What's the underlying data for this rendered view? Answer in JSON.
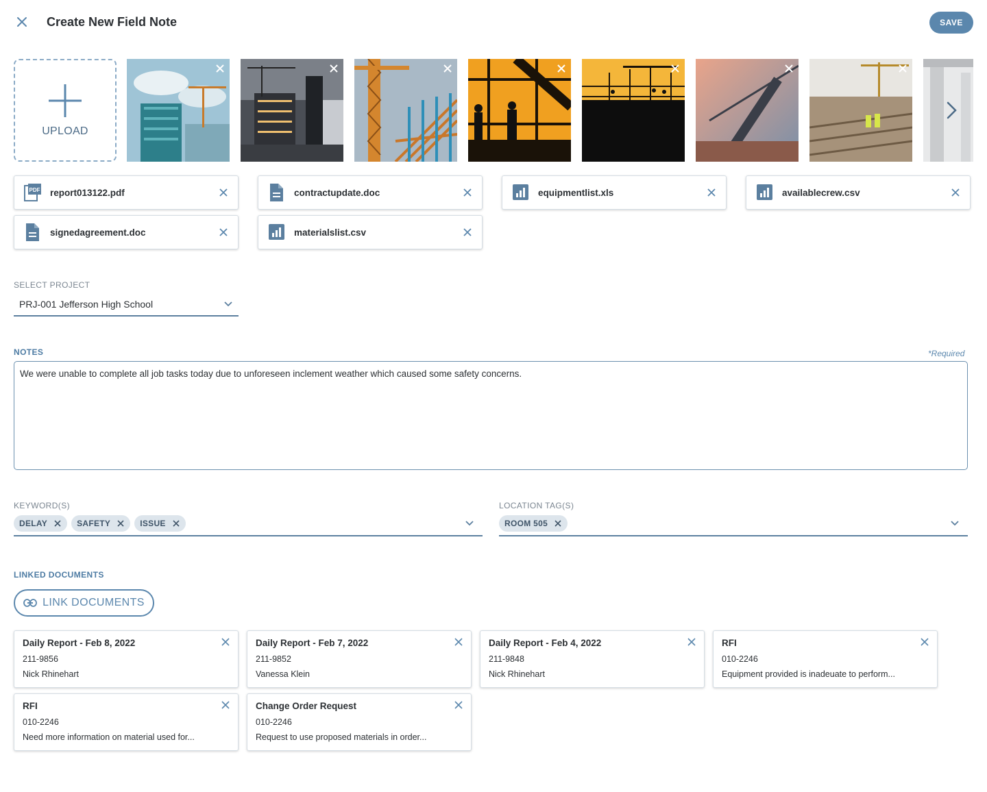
{
  "header": {
    "title": "Create New Field Note",
    "save_label": "SAVE"
  },
  "media": {
    "upload_label": "UPLOAD",
    "photos": [
      {
        "name": "glass-tower-crane"
      },
      {
        "name": "night-construction-site"
      },
      {
        "name": "tower-crane-rebar"
      },
      {
        "name": "sunset-worker-silhouettes"
      },
      {
        "name": "sunset-scaffolding-silhouette"
      },
      {
        "name": "crane-sky-haze"
      },
      {
        "name": "building-site-workers"
      },
      {
        "name": "concrete-columns"
      }
    ]
  },
  "files": [
    {
      "name": "report013122.pdf",
      "icon": "pdf-icon"
    },
    {
      "name": "contractupdate.doc",
      "icon": "document-icon"
    },
    {
      "name": "equipmentlist.xls",
      "icon": "spreadsheet-chart-icon"
    },
    {
      "name": "availablecrew.csv",
      "icon": "spreadsheet-chart-icon"
    },
    {
      "name": "signedagreement.doc",
      "icon": "document-icon"
    },
    {
      "name": "materialslist.csv",
      "icon": "spreadsheet-chart-icon"
    }
  ],
  "project": {
    "label": "SELECT PROJECT",
    "value": "PRJ-001 Jefferson High School"
  },
  "notes": {
    "label": "NOTES",
    "required": "*Required",
    "value": "We were unable to complete all job tasks today due to unforeseen inclement weather which caused some safety concerns."
  },
  "keywords": {
    "label": "KEYWORD(S)",
    "tags": [
      "DELAY",
      "SAFETY",
      "ISSUE"
    ]
  },
  "locations": {
    "label": "LOCATION TAG(S)",
    "tags": [
      "ROOM 505"
    ]
  },
  "linked": {
    "label": "LINKED DOCUMENTS",
    "button_label": "LINK DOCUMENTS",
    "docs": [
      {
        "title": "Daily Report - Feb 8, 2022",
        "line1": "211-9856",
        "line2": "Nick Rhinehart"
      },
      {
        "title": "Daily Report - Feb 7, 2022",
        "line1": "211-9852",
        "line2": "Vanessa Klein"
      },
      {
        "title": "Daily Report - Feb 4, 2022",
        "line1": "211-9848",
        "line2": "Nick Rhinehart"
      },
      {
        "title": "RFI",
        "line1": "010-2246",
        "line2": "Equipment provided is inadeuate to perform..."
      },
      {
        "title": "RFI",
        "line1": "010-2246",
        "line2": "Need more information on material used for..."
      },
      {
        "title": "Change Order Request",
        "line1": "010-2246",
        "line2": "Request to use proposed materials in order..."
      }
    ]
  },
  "colors": {
    "accent": "#5b87ad",
    "accent_dark": "#4d7ba3",
    "tag_bg": "#dde5ec",
    "border": "#d5dde4"
  }
}
